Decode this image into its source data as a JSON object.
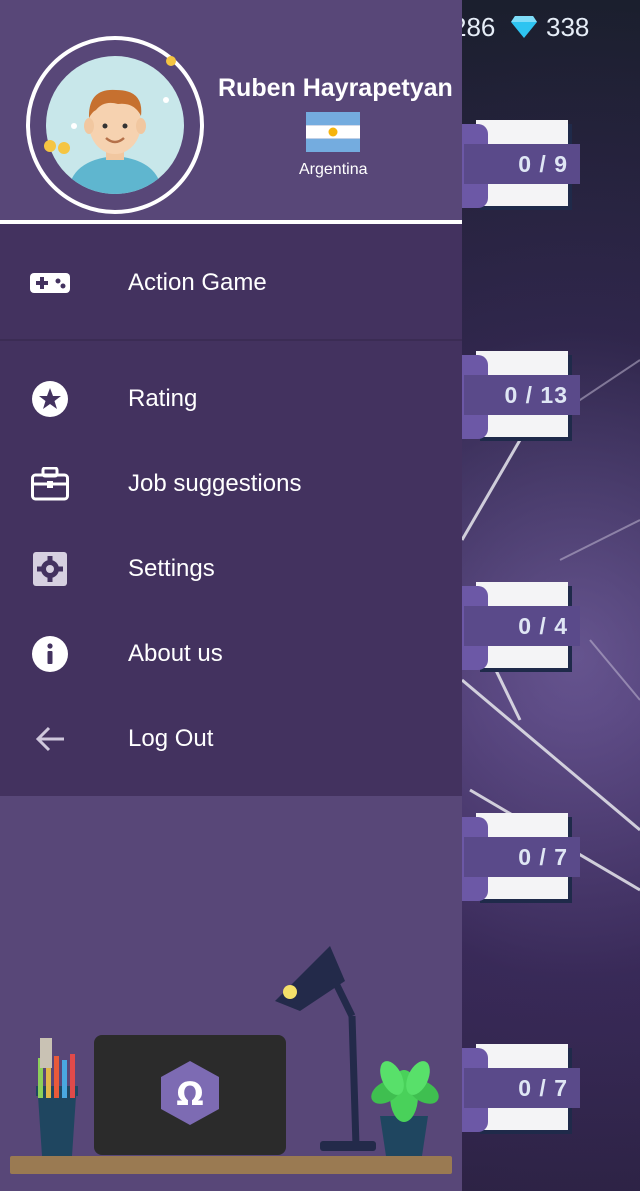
{
  "stats": {
    "coins": "286",
    "gems": "338"
  },
  "levels": [
    {
      "progress": "0 / 9"
    },
    {
      "progress": "0 / 13"
    },
    {
      "progress": "0 / 4"
    },
    {
      "progress": "0 / 7"
    },
    {
      "progress": "0 / 7"
    }
  ],
  "profile": {
    "name": "Ruben Hayrapetyan",
    "country": "Argentina"
  },
  "menu": {
    "items": [
      {
        "label": "Action Game",
        "icon": "gamepad-icon"
      },
      {
        "label": "Rating",
        "icon": "star-icon"
      },
      {
        "label": "Job suggestions",
        "icon": "briefcase-icon"
      },
      {
        "label": "Settings",
        "icon": "gear-icon"
      },
      {
        "label": "About us",
        "icon": "info-icon"
      },
      {
        "label": "Log Out",
        "icon": "arrow-left-icon"
      }
    ]
  },
  "colors": {
    "drawer": "#584778",
    "menu_bg": "#43325f",
    "accent": "#6c58a6"
  }
}
